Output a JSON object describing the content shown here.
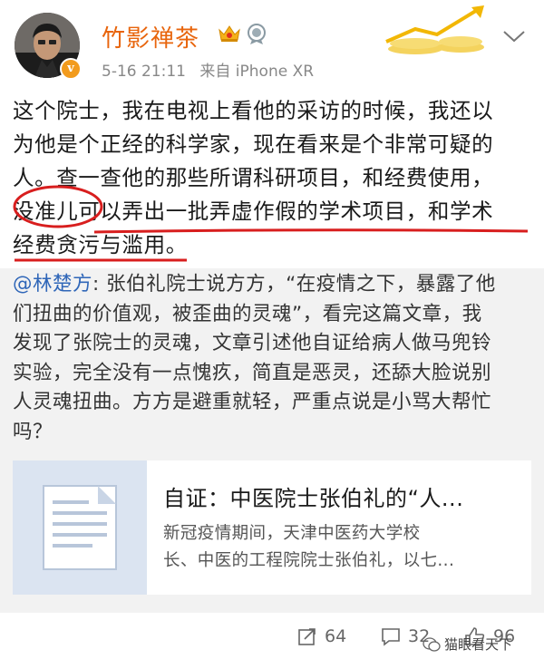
{
  "header": {
    "username": "竹影禅茶",
    "time": "5-16 21:11",
    "source": "来自 iPhone XR",
    "verified_mark": "v",
    "icons": [
      "crown-icon",
      "medal-icon",
      "chevron-down-icon"
    ]
  },
  "post": {
    "lines": [
      "这个院士，我在电视上看他的采访的时候，我还以",
      "为他是个正经的科学家，现在看来是个非常可疑的",
      "人。查一查他的那些所谓科研项目，和经费使用，",
      "没准儿可以弄出一批弄虚作假的学术项目，和学术",
      "经费贪污与滥用。"
    ]
  },
  "quote": {
    "mention": "@林楚方",
    "line1_rest": ": 张伯礼院士说方方，“在疫情之下，暴露了他",
    "lines": [
      "们扭曲的价值观，被歪曲的灵魂”，看完这篇文章，我",
      "发现了张院士的灵魂，文章引述他自证给病人做马兜铃",
      "实验，完全没有一点愧疚，简直是恶灵，还舔大脸说别",
      "人灵魂扭曲。方方是避重就轻，严重点说是小骂大帮忙",
      "吗？"
    ],
    "card": {
      "title": "自证：中医院士张伯礼的“人...",
      "desc_lines": [
        "新冠疫情期间，天津中医药大学校",
        "长、中医的工程院院士张伯礼，以七..."
      ]
    }
  },
  "actions": {
    "repost_count": "64",
    "comment_count": "32",
    "like_count": "96"
  },
  "watermark": "猫眼看天下",
  "colors": {
    "username": "#e8650d",
    "mention": "#2f66b8",
    "underline": "#d81e1e",
    "quote_bg": "#f2f2f2"
  }
}
